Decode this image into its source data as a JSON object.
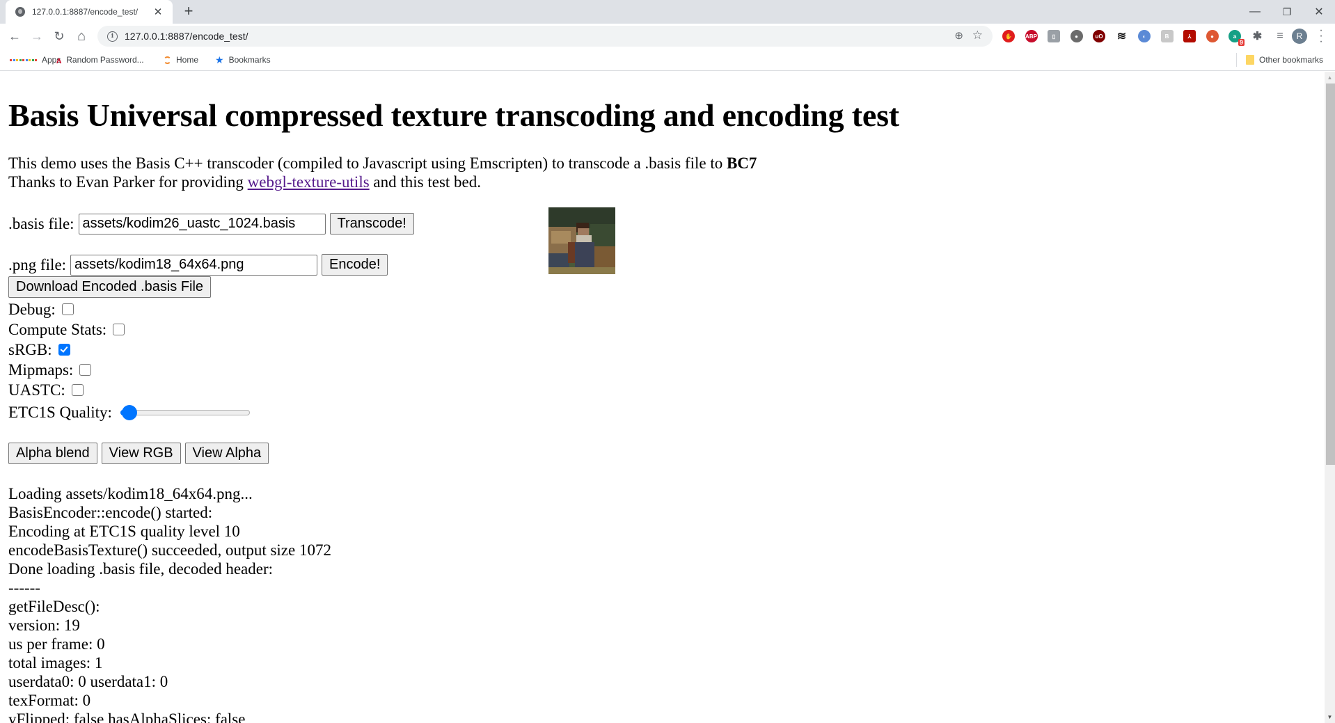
{
  "browser": {
    "tab": {
      "title": "127.0.0.1:8887/encode_test/",
      "favicon": "globe-icon"
    },
    "new_tab_label": "+",
    "window_controls": {
      "minimize": "—",
      "restore": "❐",
      "close": "✕"
    },
    "toolbar": {
      "back": "←",
      "forward": "→",
      "reload": "↻",
      "home": "⌂",
      "url": "127.0.0.1:8887/encode_test/",
      "info_glyph": "i",
      "zoom_glyph": "⊕",
      "star_glyph": "☆",
      "extensions": [
        {
          "name": "adblock-icon",
          "label": "✋",
          "color": "#e01d1d"
        },
        {
          "name": "abp-icon",
          "label": "ABP",
          "color": "#c70d2c"
        },
        {
          "name": "office-icon",
          "label": "▯",
          "color": "#9aa0a6"
        },
        {
          "name": "circle-ext-icon",
          "label": "●",
          "color": "#6b6b6b"
        },
        {
          "name": "ublock-icon",
          "label": "uO",
          "color": "#800000"
        },
        {
          "name": "buffer-icon",
          "label": "≋",
          "color": "#1a1a1a"
        },
        {
          "name": "jsonviewer-icon",
          "label": "◐",
          "color": "#5b8ad6"
        },
        {
          "name": "bitwarden-icon",
          "label": "B",
          "color": "#c8c8c8"
        },
        {
          "name": "acrobat-icon",
          "label": "⅄",
          "color": "#b30b00"
        },
        {
          "name": "duckduckgo-icon",
          "label": "●",
          "color": "#de5833"
        },
        {
          "name": "grammarly-icon",
          "label": "a",
          "color": "#15a085",
          "badge": "9"
        },
        {
          "name": "puzzle-icon",
          "label": "✱",
          "color": "#5f6368"
        },
        {
          "name": "media-icon",
          "label": "≡",
          "color": "#5f6368"
        }
      ],
      "avatar_letter": "R"
    },
    "bookmarks": [
      {
        "name": "bookmark-apps",
        "label": "Apps",
        "icon": "apps-grid-icon"
      },
      {
        "name": "bookmark-random-password",
        "label": "Random Password...",
        "icon": "lastpass-icon"
      },
      {
        "name": "bookmark-home",
        "label": "Home",
        "icon": "home-ring-icon"
      },
      {
        "name": "bookmark-bookmarks",
        "label": "Bookmarks",
        "icon": "star-icon"
      }
    ],
    "other_bookmarks": "Other bookmarks"
  },
  "page": {
    "title": "Basis Universal compressed texture transcoding and encoding test",
    "intro_line1_prefix": "This demo uses the Basis C++ transcoder (compiled to Javascript using Emscripten) to transcode a .basis file to ",
    "intro_line1_format": "BC7",
    "intro_line2_prefix": "Thanks to Evan Parker for providing ",
    "intro_link": "webgl-texture-utils",
    "intro_line2_suffix": " and this test bed.",
    "basis_file": {
      "label": ".basis file:",
      "value": "assets/kodim26_uastc_1024.basis",
      "button": "Transcode!"
    },
    "png_file": {
      "label": ".png file:",
      "value": "assets/kodim18_64x64.png",
      "button": "Encode!"
    },
    "download_button": "Download Encoded .basis File",
    "options": [
      {
        "name": "debug",
        "label": "Debug:",
        "checked": false
      },
      {
        "name": "compute-stats",
        "label": "Compute Stats:",
        "checked": false
      },
      {
        "name": "srgb",
        "label": "sRGB:",
        "checked": true
      },
      {
        "name": "mipmaps",
        "label": "Mipmaps:",
        "checked": false
      },
      {
        "name": "uastc",
        "label": "UASTC:",
        "checked": false
      }
    ],
    "quality": {
      "label": "ETC1S Quality:",
      "value": 10,
      "min": 1,
      "max": 255
    },
    "view_buttons": [
      "Alpha blend",
      "View RGB",
      "View Alpha"
    ],
    "log": [
      "Loading assets/kodim18_64x64.png...",
      "BasisEncoder::encode() started:",
      "Encoding at ETC1S quality level 10",
      "encodeBasisTexture() succeeded, output size 1072",
      "Done loading .basis file, decoded header:",
      "------",
      "getFileDesc():",
      "version: 19",
      "us per frame: 0",
      "total images: 1",
      "userdata0: 0 userdata1: 0",
      "texFormat: 0",
      "yFlipped: false hasAlphaSlices: false"
    ]
  },
  "colors": {
    "accent": "#0075ff",
    "link_visited": "#551a8b",
    "tabstrip": "#dee1e6",
    "omnibox": "#f1f3f4"
  }
}
